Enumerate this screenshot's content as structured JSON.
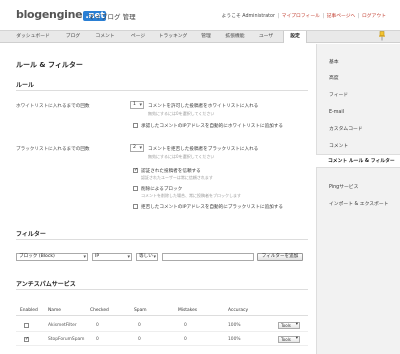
{
  "header": {
    "logo_main": "blogengine",
    "logo_suffix": ".net",
    "title": "マイブログ 管理",
    "welcome": "ようこそ Administrator",
    "links": [
      "マイプロフィール",
      "記事ページへ",
      "ログアウト"
    ]
  },
  "nav": {
    "items": [
      "ダッシュボード",
      "ブログ",
      "コメント",
      "ページ",
      "トラッキング",
      "管理",
      "拡張機能",
      "ユーザ",
      "設定"
    ],
    "active_index": 8
  },
  "main": {
    "page_title": "ルール & フィルター",
    "rules_heading": "ルール",
    "whitelist_label": "ホワイトリストに入れるまでの回数",
    "whitelist_count": "1",
    "whitelist_text": "コメントを許可した投稿者をホワイトリストに入れる",
    "whitelist_hint": "無効にするには0を選択してください",
    "auto_whitelist_text": "承認したコメントのIPアドレスを自動的にホワイトリストに追加する",
    "blacklist_label": "ブラックリストに入れるまでの回数",
    "blacklist_count": "2",
    "blacklist_text": "コメントを拒否した投稿者をブラックリストに入れる",
    "blacklist_hint": "無効にするには0を選択してください",
    "trust_text": "認証された投稿者を信頼する",
    "trust_hint": "認証されたユーザーは常に信頼されます",
    "block_text": "削除によるブロック",
    "block_hint": "コメントを削除した場合、常に投稿者をブロックします",
    "auto_blacklist_text": "拒否したコメントのIPアドレスを自動的にブラックリストに追加する",
    "filters_heading": "フィルター",
    "filter_action": "ブロック (Block)",
    "filter_field": "IP",
    "filter_op": "等しい",
    "add_filter_label": "フィルターを追加",
    "antispam_heading": "アンチスパムサービス",
    "columns": [
      "Enabled",
      "Name",
      "Checked",
      "Spam",
      "Mistakes",
      "Accuracy"
    ],
    "rows": [
      {
        "name": "AkismetFilter",
        "checked": "0",
        "spam": "0",
        "mistakes": "0",
        "accuracy": "100%",
        "tools": "Tools"
      },
      {
        "name": "StopForumSpam",
        "checked": "0",
        "spam": "0",
        "mistakes": "0",
        "accuracy": "100%",
        "tools": "Tools"
      }
    ]
  },
  "sidebar": {
    "items": [
      "基本",
      "高度",
      "フィード",
      "E-mail",
      "カスタムコード",
      "コメント",
      "コメント ルール & フィルター",
      "Pingサービス",
      "インポート & エクスポート"
    ],
    "active_index": 6
  }
}
